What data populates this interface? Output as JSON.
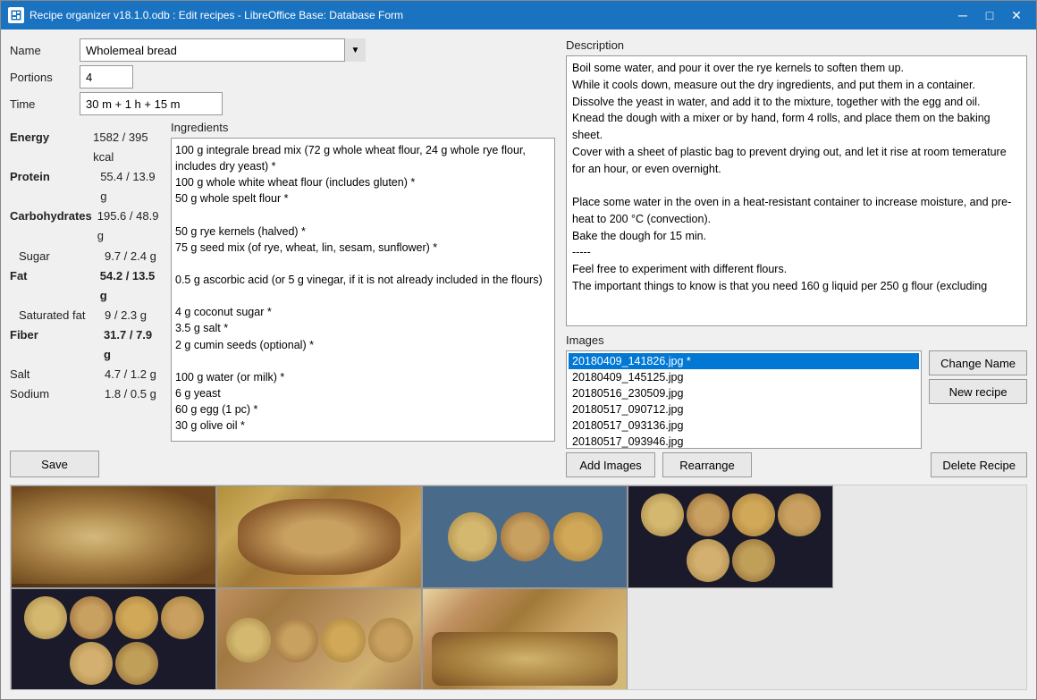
{
  "window": {
    "title": "Recipe organizer v18.1.0.odb : Edit recipes - LibreOffice Base: Database Form",
    "icon": "db-icon"
  },
  "form": {
    "name_label": "Name",
    "name_value": "Wholemeal bread",
    "portions_label": "Portions",
    "portions_value": "4",
    "time_label": "Time",
    "time_value": "30 m + 1 h + 15 m"
  },
  "nutrients": {
    "energy_label": "Energy",
    "energy_value": "1582 / 395 kcal",
    "protein_label": "Protein",
    "protein_value": "55.4 / 13.9 g",
    "carbohydrates_label": "Carbohydrates",
    "carbohydrates_value": "195.6 / 48.9 g",
    "sugar_label": "Sugar",
    "sugar_value": "9.7 / 2.4 g",
    "fat_label": "Fat",
    "fat_value": "54.2 / 13.5 g",
    "saturated_fat_label": "Saturated fat",
    "saturated_fat_value": "9 / 2.3 g",
    "fiber_label": "Fiber",
    "fiber_value": "31.7 / 7.9 g",
    "salt_label": "Salt",
    "salt_value": "4.7 / 1.2 g",
    "sodium_label": "Sodium",
    "sodium_value": "1.8 / 0.5 g"
  },
  "ingredients": {
    "label": "Ingredients",
    "content": "100 g integrale bread mix (72 g whole wheat flour, 24 g whole rye flour, includes dry yeast) *\n100 g whole white wheat flour (includes gluten) *\n50 g whole spelt flour *\n\n50 g rye kernels (halved) *\n75 g seed mix (of rye, wheat, lin, sesam, sunflower) *\n\n0.5 g ascorbic acid (or 5 g vinegar, if it is not already included in the flours)\n\n4 g coconut sugar *\n3.5 g salt *\n2 g cumin seeds (optional) *\n\n100 g water (or milk) *\n6 g yeast\n60 g egg (1 pc) *\n30 g olive oil *"
  },
  "description": {
    "label": "Description",
    "content": "Boil some water, and pour it over the rye kernels to soften them up.\nWhile it cools down, measure out the dry ingredients, and put them in a container.\nDissolve the yeast in water, and add it to the mixture, together with the egg and oil.\nKnead the dough with a mixer or by hand, form 4 rolls, and place them on the baking sheet.\nCover with a sheet of plastic bag to prevent drying out, and let it rise at room temerature for an hour, or even overnight.\n\nPlace some water in the oven in a heat-resistant container to increase moisture, and pre-heat to 200 °C (convection).\nBake the dough for 15 min.\n-----\nFeel free to experiment with different flours.\nThe important things to know is that you need 160 g liquid per 250 g flour (excluding"
  },
  "images": {
    "label": "Images",
    "files": [
      {
        "name": "20180409_141826.jpg *",
        "selected": true
      },
      {
        "name": "20180409_145125.jpg"
      },
      {
        "name": "20180516_230509.jpg"
      },
      {
        "name": "20180517_090712.jpg"
      },
      {
        "name": "20180517_093136.jpg"
      },
      {
        "name": "20180517_093946.jpg"
      }
    ],
    "change_name_btn": "Change Name",
    "new_recipe_btn": "New recipe",
    "add_images_btn": "Add Images",
    "rearrange_btn": "Rearrange",
    "delete_recipe_btn": "Delete Recipe"
  },
  "buttons": {
    "save": "Save"
  },
  "titlebar": {
    "minimize": "─",
    "maximize": "□",
    "close": "✕"
  }
}
